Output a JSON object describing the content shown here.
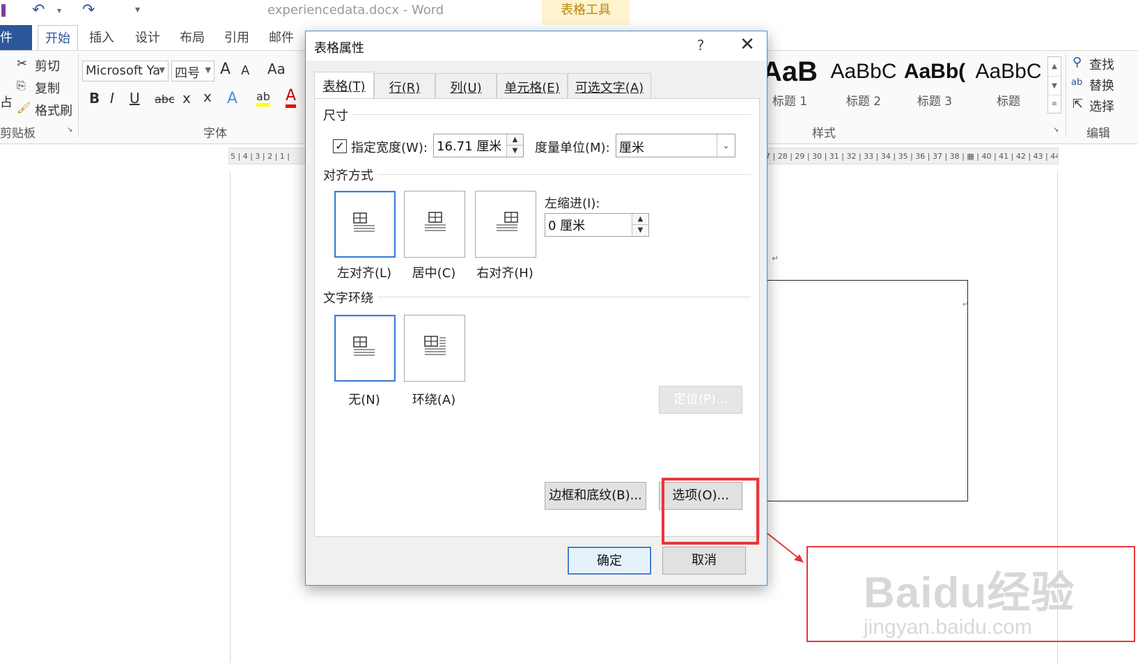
{
  "window": {
    "doc_title": "experiencedata.docx - Word",
    "contextual_tab": "表格工具"
  },
  "ribbon": {
    "tabs": [
      "件",
      "开始",
      "插入",
      "设计",
      "布局",
      "引用",
      "邮件"
    ],
    "clipboard": {
      "cut": "剪切",
      "copy": "复制",
      "format_painter": "格式刷",
      "paste_partial": "占",
      "group": "剪贴板"
    },
    "font": {
      "font_name": "Microsoft Ya",
      "font_size": "四号",
      "grow": "A",
      "shrink": "A",
      "case": "Aa",
      "bold": "B",
      "italic": "I",
      "underline": "U",
      "strike": "abc",
      "sub": "x",
      "sup": "x",
      "effects": "A",
      "highlight": "ab",
      "color": "A",
      "group": "字体"
    },
    "styles": {
      "items": [
        {
          "sample": "AaB",
          "name": "标题 1"
        },
        {
          "sample": "AaBbC",
          "name": "标题 2"
        },
        {
          "sample": "AaBb(",
          "name": "标题 3"
        },
        {
          "sample": "AaBbC",
          "name": "标题"
        }
      ],
      "group": "样式"
    },
    "editing": {
      "find": "查找",
      "replace": "替换",
      "select": "选择",
      "group": "编辑"
    }
  },
  "ruler": {
    "left_text": "5 | 4 | 3 | 2 | 1 |",
    "right_text": "7 | 28 | 29 | 30 | 31 | 32 | 33 | 34 | 35 | 36 | 37 | 38 | ▦ | 40 | 41 | 42 | 43 | 44"
  },
  "document": {
    "para_mark": "↵",
    "cell_mark": "↵"
  },
  "dialog": {
    "title": "表格属性",
    "help": "?",
    "close": "✕",
    "tabs": [
      "表格(T)",
      "行(R)",
      "列(U)",
      "单元格(E)",
      "可选文字(A)"
    ],
    "size_section": "尺寸",
    "preferred_width_label": "指定宽度(W):",
    "preferred_width_checked": true,
    "preferred_width_value": "16.71 厘米",
    "measure_label": "度量单位(M):",
    "measure_value": "厘米",
    "alignment_section": "对齐方式",
    "align_left": "左对齐(L)",
    "align_center": "居中(C)",
    "align_right": "右对齐(H)",
    "indent_label": "左缩进(I):",
    "indent_value": "0 厘米",
    "wrap_section": "文字环绕",
    "wrap_none": "无(N)",
    "wrap_around": "环绕(A)",
    "position_button": "定位(P)...",
    "borders_button": "边框和底纹(B)...",
    "options_button": "选项(O)...",
    "ok_button": "确定",
    "cancel_button": "取消"
  },
  "watermark": {
    "main": "Baidu经验",
    "url": "jingyan.baidu.com"
  },
  "colors": {
    "accent": "#2b579a",
    "annotation": "#e8363c",
    "focus": "#3c7fd6"
  }
}
